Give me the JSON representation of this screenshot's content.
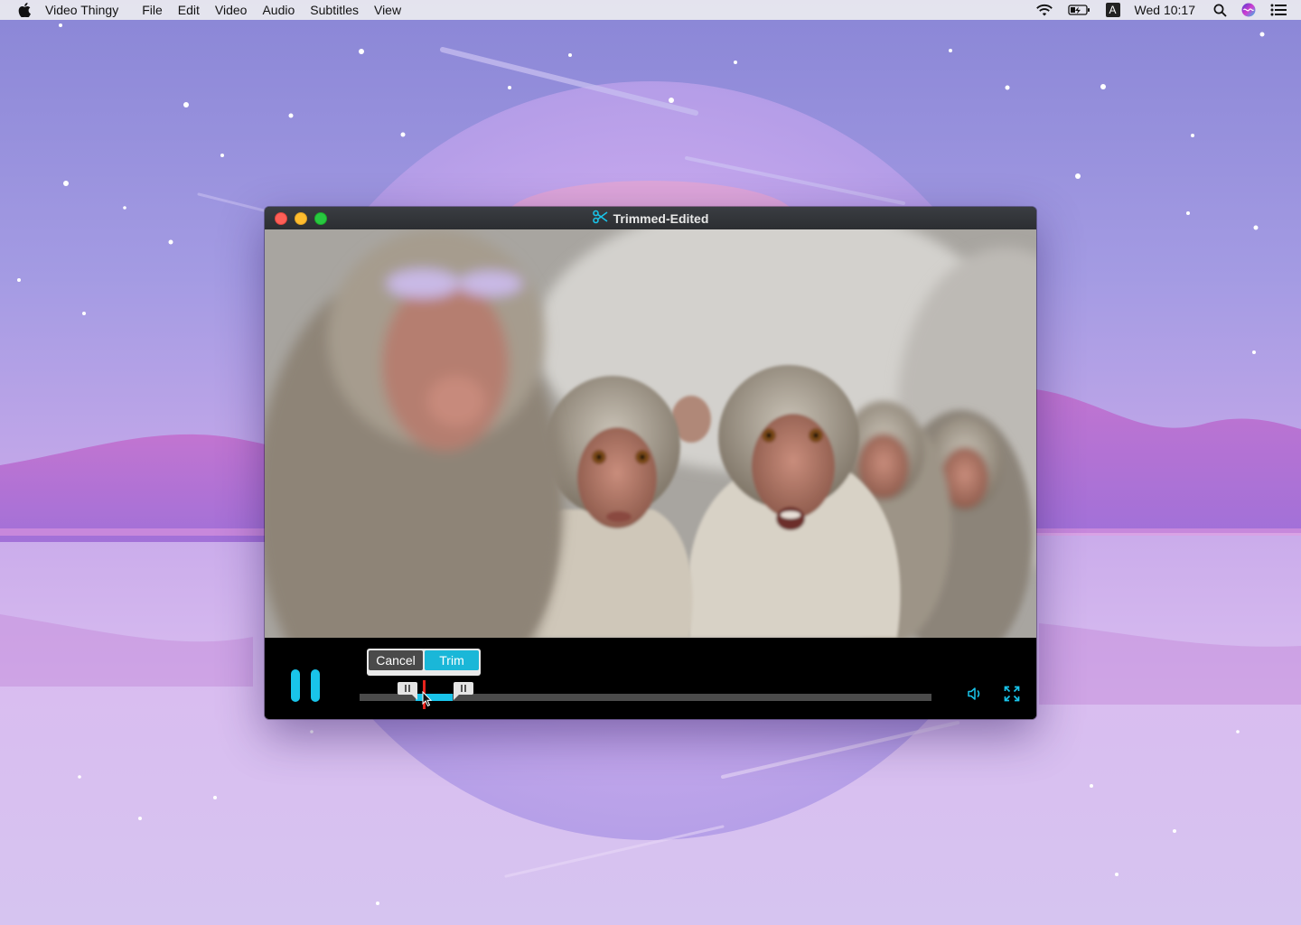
{
  "menubar": {
    "app_name": "Video Thingy",
    "menus": [
      "File",
      "Edit",
      "Video",
      "Audio",
      "Subtitles",
      "View"
    ],
    "clock": "Wed 10:17",
    "input_source": "A",
    "status_icons": [
      "wifi-icon",
      "battery-charging-icon",
      "input-source-icon",
      "spotlight-search-icon",
      "siri-icon",
      "notification-center-icon"
    ]
  },
  "window": {
    "title": "Trimmed-Edited",
    "title_icon": "scissors-icon"
  },
  "trim": {
    "cancel_label": "Cancel",
    "trim_label": "Trim"
  },
  "colors": {
    "accent": "#19c4ea",
    "playhead": "#e8231c",
    "close": "#fe5f57",
    "minimize": "#febc2e",
    "zoom": "#28c840"
  }
}
